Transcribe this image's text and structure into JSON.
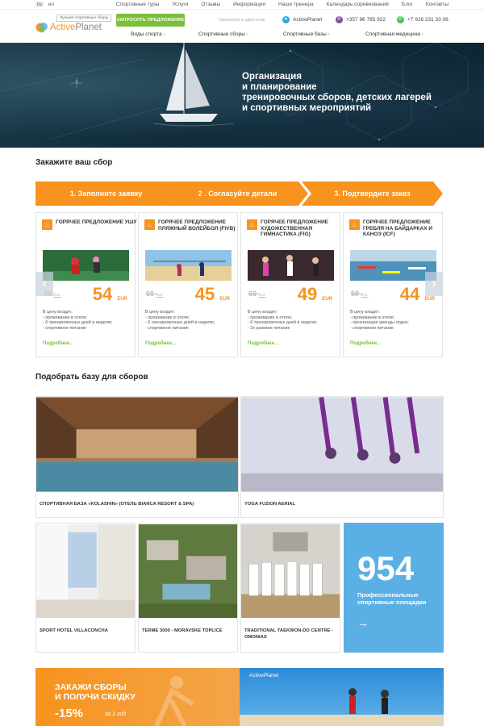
{
  "topbar": {
    "langs": [
      "ru",
      "en"
    ],
    "nav": [
      "Спортивные туры",
      "Услуги",
      "Отзывы",
      "Информация",
      "Наши тренера",
      "Календарь соревнований",
      "Блог",
      "Контакты"
    ]
  },
  "header": {
    "logo_active": "Active",
    "logo_planet": "Planet",
    "tagline": "Лучшие спортивные сборы",
    "cta": "ЗАПРОСИТЬ ПРЕДЛОЖЕНИЕ",
    "contact_label": "Связаться в один клик:",
    "telegram": "ActivePlanet",
    "viber": "+357 96 785 922",
    "whatsapp": "+7 926 231 33 06",
    "nav": [
      "Виды спорта",
      "Спортивные сборы",
      "Спортивные базы",
      "Спортивная медицина"
    ]
  },
  "hero": {
    "lines": [
      "Организация",
      "и планирование",
      "тренировочных сборов, детских лагерей",
      "и спортивных мероприятий"
    ]
  },
  "order": {
    "title": "Закажите ваш сбор",
    "steps": [
      "1. Заполните заявку",
      "2 . Согласуйте детали",
      "3. Подтвердите заказ"
    ]
  },
  "offers": [
    {
      "title": "ГОРЯЧЕЕ ПРЕДЛОЖЕНИЕ УШУ",
      "old": "70",
      "new": "54",
      "items": [
        "прожевание в отеле;",
        "6 тренировочных дней в неделю;",
        "спортивное питание"
      ]
    },
    {
      "title": "ГОРЯЧЕЕ ПРЕДЛОЖЕНИЕ ПЛЯЖНЫЙ ВОЛЕЙБОЛ (FIVB)",
      "old": "60",
      "new": "45",
      "items": [
        "прожевание в отеле;",
        "6 тренировочных дней в неделю;",
        "спортивное питание"
      ]
    },
    {
      "title": "ГОРЯЧЕЕ ПРЕДЛОЖЕНИЕ ХУДОЖЕСТВЕННАЯ ГИМНАСТИКА (FIG)",
      "old": "60",
      "new": "49",
      "items": [
        "прожевание в отеле;",
        "6 тренировочных дней в неделю;",
        "3х разовое питание"
      ]
    },
    {
      "title": "ГОРЯЧЕЕ ПРЕДЛОЖЕНИЕ ГРЕБЛЯ НА БАЙДАРКАХ И КАНОЭ (ICF)",
      "old": "59",
      "new": "44",
      "items": [
        "прожевание в отеле;",
        "организация аренды лодок;",
        "спортивное питание"
      ]
    }
  ],
  "offer_common": {
    "currency": "EUR",
    "old_unit": "Eur.",
    "includes": "В цену входит:",
    "more": "Подробнее...",
    "prev": "‹",
    "next": "›"
  },
  "bases": {
    "title": "Подобрать базу для сборов",
    "items": [
      "СПОРТИВНАЯ БАЗА «KOLASHIN» (ОТЕЛЬ BIANCA RESORT & SPA)",
      "YOGA FUZION AERIAL",
      "SPORT HOTEL VILLACONCHA",
      "TERME 3000 - MORAVSKE TOPLICE",
      "TRADITIONAL TAEKWON-DO CENTRE - OMONIAS"
    ],
    "stat_number": "954",
    "stat_text": "Профессиональные спортивные площадки",
    "stat_arrow": "→"
  },
  "promo": {
    "line1": "ЗАКАЖИ СБОРЫ",
    "line2": "И ПОЛУЧИ СКИДКУ",
    "discount": "-15%",
    "per": "за 1 год",
    "logo": "ActivePlanet"
  },
  "colors": {
    "orange": "#f7931e",
    "green": "#7bbf3a",
    "blue": "#5ab0e4"
  }
}
